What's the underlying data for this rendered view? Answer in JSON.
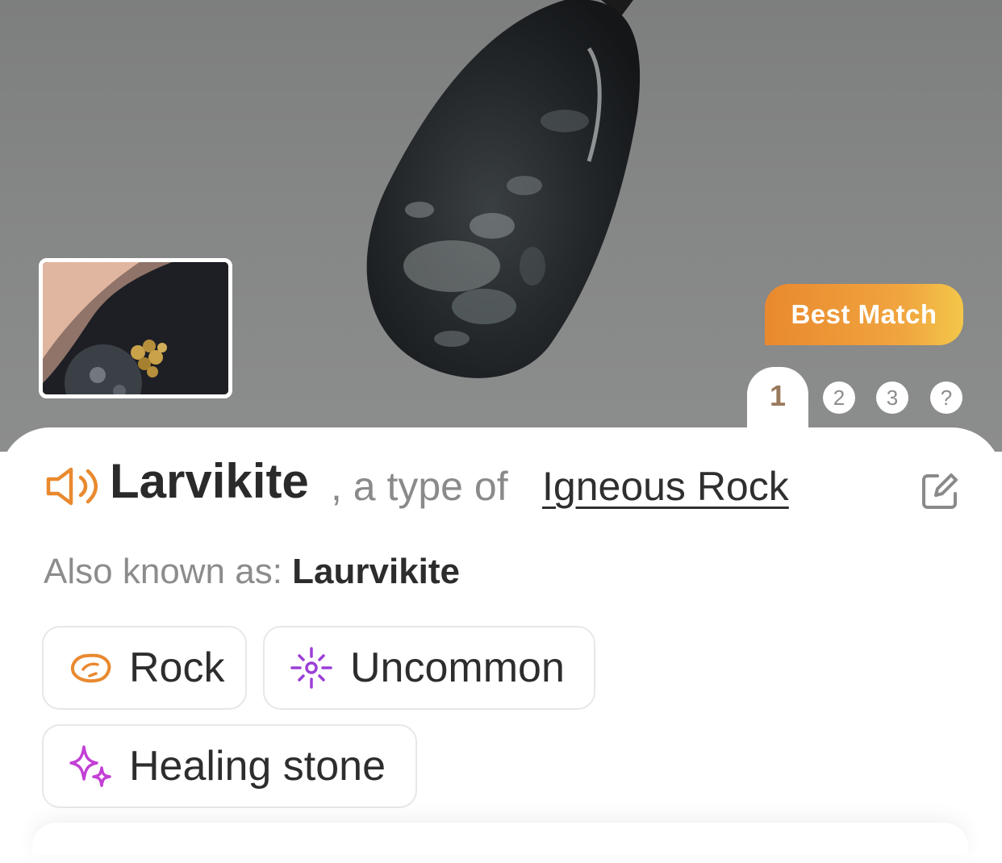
{
  "hero": {
    "badge_label": "Best Match",
    "pager": {
      "active": "1",
      "items": [
        "2",
        "3",
        "?"
      ]
    }
  },
  "result": {
    "name": "Larvikite",
    "type_prefix": ", a type of ",
    "type_link": "Igneous Rock",
    "aka_label": "Also known as: ",
    "aka_value": "Laurvikite"
  },
  "tags": [
    {
      "label": "Rock",
      "icon": "rock-icon",
      "color": "#e9892f"
    },
    {
      "label": "Uncommon",
      "icon": "sparkle-burst-icon",
      "color": "#9b3fd6"
    },
    {
      "label": "Healing stone",
      "icon": "sparkles-icon",
      "color": "#c33fd6"
    }
  ],
  "colors": {
    "accent_orange": "#e9892f",
    "accent_gold": "#f3c74a",
    "pager_active": "#9a7a5e"
  }
}
